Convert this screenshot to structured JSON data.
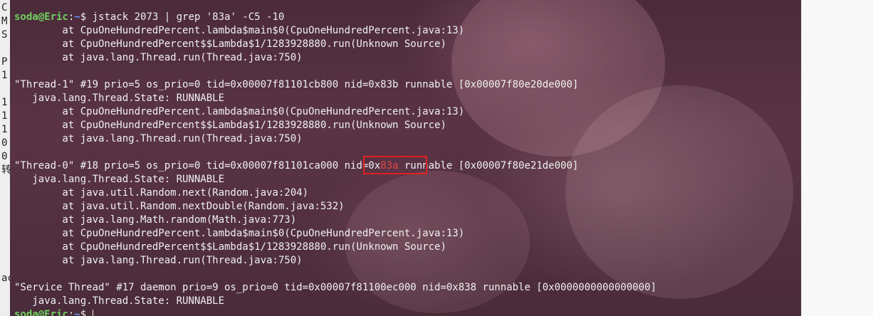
{
  "left_strip": {
    "chars": [
      "C",
      "M",
      "S",
      "",
      "P",
      "1",
      "",
      "1",
      "1",
      "1",
      "0",
      "0",
      "转",
      "",
      "",
      "",
      "",
      "",
      "",
      "",
      "ac",
      ""
    ]
  },
  "terminal": {
    "prompt_user": "soda@Eric",
    "prompt_sep": ":",
    "prompt_path": "~",
    "prompt_symbol": "$ ",
    "command": "jstack 2073 | grep '83a' -C5 -10",
    "lines": [
      "        at CpuOneHundredPercent.lambda$main$0(CpuOneHundredPercent.java:13)",
      "        at CpuOneHundredPercent$$Lambda$1/1283928880.run(Unknown Source)",
      "        at java.lang.Thread.run(Thread.java:750)",
      "",
      "\"Thread-1\" #19 prio=5 os_prio=0 tid=0x00007f81101cb800 nid=0x83b runnable [0x00007f80e20de000]",
      "   java.lang.Thread.State: RUNNABLE",
      "        at CpuOneHundredPercent.lambda$main$0(CpuOneHundredPercent.java:13)",
      "        at CpuOneHundredPercent$$Lambda$1/1283928880.run(Unknown Source)",
      "        at java.lang.Thread.run(Thread.java:750)",
      ""
    ],
    "thread0_prefix": "\"Thread-0\" #18 prio=5 os_prio=0 tid=0x00007f81101ca000 nid=0x",
    "thread0_match": "83a",
    "thread0_suffix": " runnable [0x00007f80e21de000]",
    "lines_after": [
      "   java.lang.Thread.State: RUNNABLE",
      "        at java.util.Random.next(Random.java:204)",
      "        at java.util.Random.nextDouble(Random.java:532)",
      "        at java.lang.Math.random(Math.java:773)",
      "        at CpuOneHundredPercent.lambda$main$0(CpuOneHundredPercent.java:13)",
      "        at CpuOneHundredPercent$$Lambda$1/1283928880.run(Unknown Source)",
      "        at java.lang.Thread.run(Thread.java:750)",
      "",
      "\"Service Thread\" #17 daemon prio=9 os_prio=0 tid=0x00007f81100ec000 nid=0x838 runnable [0x0000000000000000]",
      "   java.lang.Thread.State: RUNNABLE"
    ]
  },
  "colors": {
    "prompt_user": "#6fd35f",
    "prompt_path": "#6a9cff",
    "match": "#e04848",
    "highlight_box": "#e02020"
  }
}
